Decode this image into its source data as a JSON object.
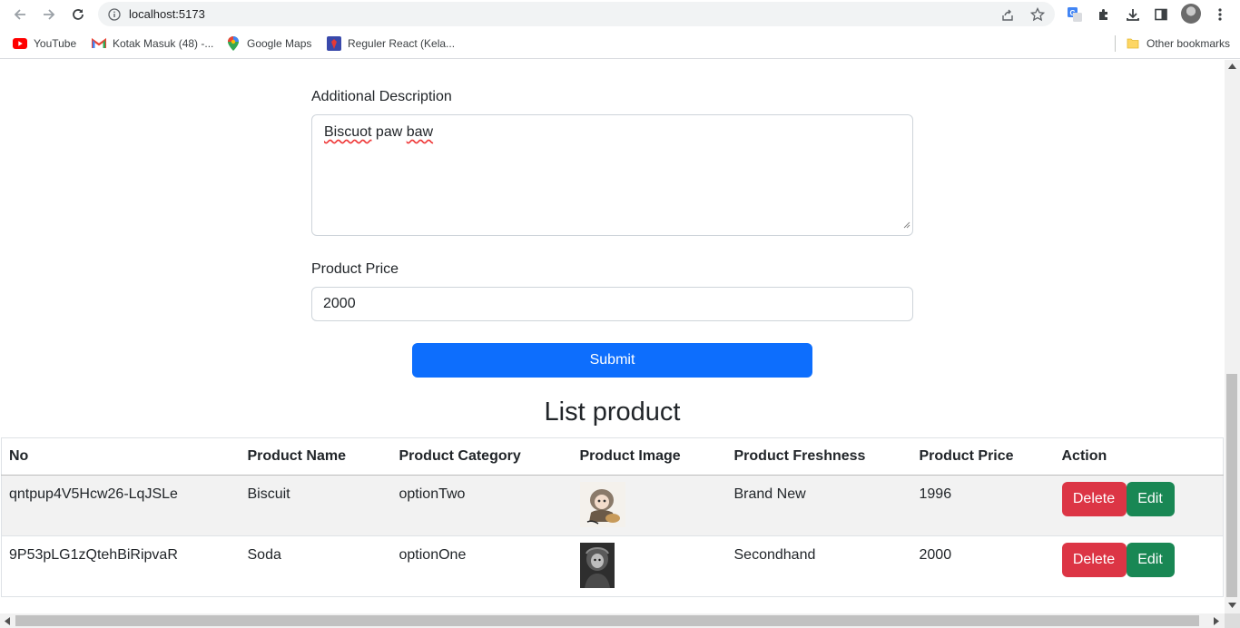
{
  "browser": {
    "url": "localhost:5173",
    "bookmarks": [
      {
        "label": "YouTube",
        "icon": "youtube-icon"
      },
      {
        "label": "Kotak Masuk (48) -...",
        "icon": "gmail-icon"
      },
      {
        "label": "Google Maps",
        "icon": "maps-icon"
      },
      {
        "label": "Reguler React (Kela...",
        "icon": "bookmark-site-icon"
      }
    ],
    "other_bookmarks": "Other bookmarks"
  },
  "form": {
    "description_label": "Additional Description",
    "description_value_misspelled": "Biscuot",
    "description_value_word2": "paw",
    "description_value_space": " ",
    "description_value_word3": "baw",
    "price_label": "Product Price",
    "price_value": "2000",
    "submit_label": "Submit"
  },
  "list": {
    "title": "List product",
    "columns": [
      "No",
      "Product Name",
      "Product Category",
      "Product Image",
      "Product Freshness",
      "Product Price",
      "Action"
    ],
    "rows": [
      {
        "no": "qntpup4V5Hcw26-LqJSLe",
        "name": "Biscuit",
        "category": "optionTwo",
        "freshness": "Brand New",
        "price": "1996"
      },
      {
        "no": "9P53pLG1zQtehBiRipvaR",
        "name": "Soda",
        "category": "optionOne",
        "freshness": "Secondhand",
        "price": "2000"
      }
    ],
    "delete_label": "Delete",
    "edit_label": "Edit"
  },
  "colors": {
    "primary": "#0d6efd",
    "danger": "#dc3545",
    "success": "#198754"
  }
}
